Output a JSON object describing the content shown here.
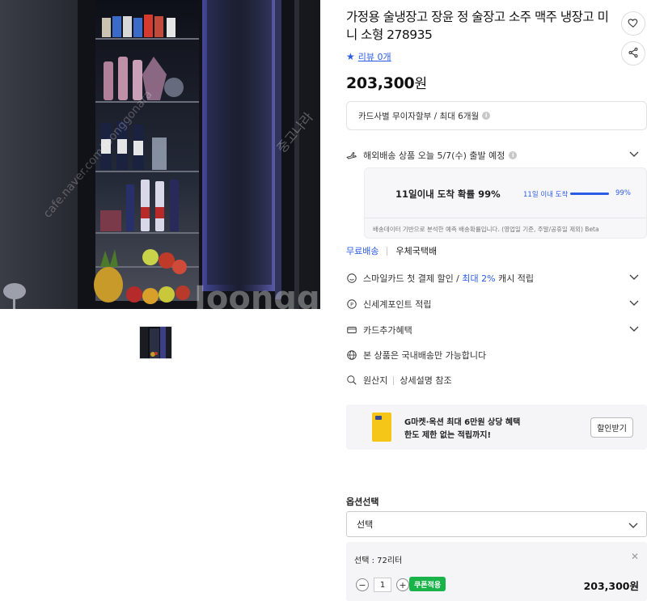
{
  "product": {
    "title": "가정용 술냉장고 장윤 정 술장고 소주 맥주 냉장고 미니 소형 278935",
    "review_label": "리뷰 0개",
    "price": "203,300",
    "currency": "원"
  },
  "actions": {
    "like_icon": "heart-icon",
    "share_icon": "share-icon"
  },
  "payment": {
    "installment_text": "카드사별 무이자할부 / 최대 6개월"
  },
  "delivery": {
    "overseas_text": "해외배송 상품 오늘 5/7(수) 출발 예정",
    "probability_text": "11일이내 도착 확률 99%",
    "bar_label": "11일 이내 도착",
    "bar_percent_text": "99%",
    "bar_fraction": 0.99,
    "note": "배송데이터 기반으로 분석한 예측 배송확률입니다. (영업일 기준, 주말/공휴일 제외) Beta",
    "shipping_fee": "무료배송",
    "shipping_method": "우체국택배"
  },
  "benefits": {
    "smile_prefix": "스마일카드 첫 결제 할인 / ",
    "smile_highlight": "최대 2%",
    "smile_suffix": " 캐시 적립",
    "points": "신세계포인트 적립",
    "card_extra": "카드추가혜택",
    "domestic": "본 상품은 국내배송만 가능합니다",
    "origin": "원산지",
    "origin_value": "상세설명 참조"
  },
  "promo": {
    "line1": "G마켓·옥션 최대 6만원 상당 혜택",
    "line2": "한도 제한 없는 적립까지!",
    "button": "할인받기"
  },
  "options": {
    "title": "옵션선택",
    "select_value": "선택",
    "selected_label": "선택 : 72리터",
    "quantity": "1",
    "coupon_label": "쿠폰적용",
    "line_price": "203,300원"
  },
  "watermarks": [
    "cafe.naver.com/joonggonara",
    "중고나라",
    "Joonggonara"
  ]
}
